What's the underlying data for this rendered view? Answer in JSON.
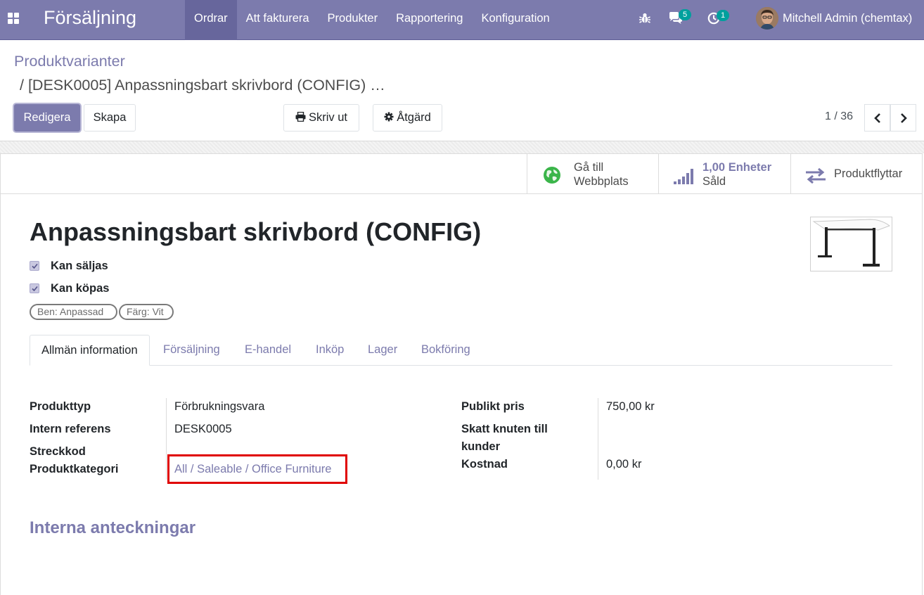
{
  "navbar": {
    "app_name": "Försäljning",
    "menu": [
      {
        "label": "Ordrar",
        "active": true
      },
      {
        "label": "Att fakturera",
        "active": false
      },
      {
        "label": "Produkter",
        "active": false
      },
      {
        "label": "Rapportering",
        "active": false
      },
      {
        "label": "Konfiguration",
        "active": false
      }
    ],
    "messages_count": "5",
    "activities_count": "1",
    "user_name": "Mitchell Admin (chemtax)",
    "icons": [
      "apps-grid-icon",
      "bug-icon",
      "chat-icon",
      "clock-icon"
    ],
    "colors": {
      "brand": "#7c7bad",
      "badge": "#00a09d"
    }
  },
  "breadcrumb": {
    "parent": "Produktvarianter",
    "current": "/ [DESK0005] Anpassningsbart skrivbord (CONFIG) …"
  },
  "toolbar": {
    "edit_label": "Redigera",
    "create_label": "Skapa",
    "print_label": "Skriv ut",
    "action_label": "Åtgärd"
  },
  "pager": {
    "value": "1 / 36"
  },
  "smart_buttons": {
    "website": {
      "line1": "Gå till",
      "line2": "Webbplats"
    },
    "sold": {
      "value": "1,00 Enheter",
      "label": "Såld"
    },
    "moves": {
      "label": "Produktflyttar"
    }
  },
  "product": {
    "name": "Anpassningsbart skrivbord (CONFIG)",
    "can_be_sold": {
      "label": "Kan säljas",
      "checked": true
    },
    "can_be_purchased": {
      "label": "Kan köpas",
      "checked": true
    },
    "attributes": [
      "Ben: Anpassad",
      "Färg: Vit"
    ]
  },
  "tabs": [
    {
      "label": "Allmän information",
      "active": true
    },
    {
      "label": "Försäljning",
      "active": false
    },
    {
      "label": "E-handel",
      "active": false
    },
    {
      "label": "Inköp",
      "active": false
    },
    {
      "label": "Lager",
      "active": false
    },
    {
      "label": "Bokföring",
      "active": false
    }
  ],
  "general_info": {
    "left": [
      {
        "label": "Produkttyp",
        "value": "Förbrukningsvara"
      },
      {
        "label": "Intern referens",
        "value": "DESK0005"
      },
      {
        "label": "Streckkod",
        "value": ""
      },
      {
        "label": "Produktkategori",
        "value": "All / Saleable / Office Furniture"
      }
    ],
    "right": [
      {
        "label": "Publikt pris",
        "value": "750,00 kr"
      },
      {
        "label_line1": "Skatt knuten till",
        "label_line2": "kunder",
        "value": ""
      },
      {
        "label": "Kostnad",
        "value": "0,00 kr"
      }
    ]
  },
  "notes_section": {
    "title": "Interna anteckningar"
  }
}
